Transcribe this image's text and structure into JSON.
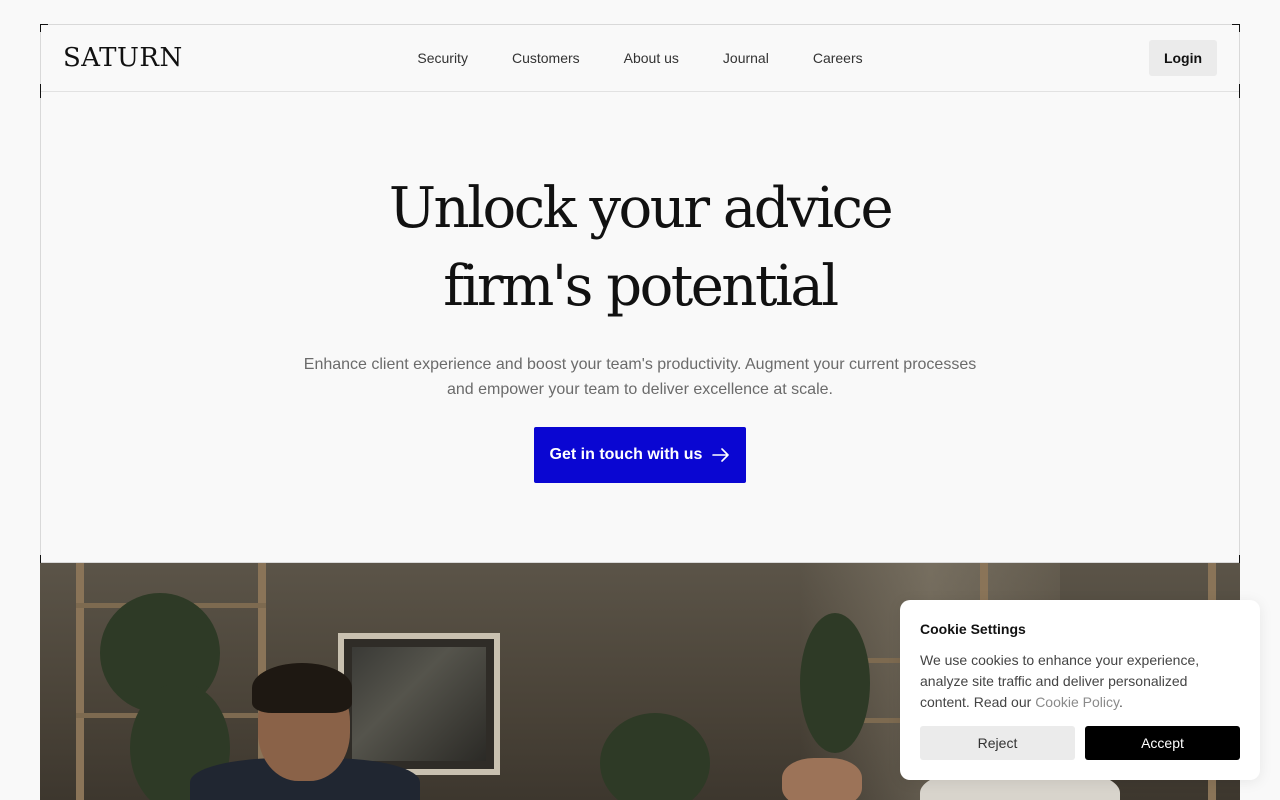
{
  "header": {
    "logo": "SATURN",
    "nav": [
      {
        "label": "Security"
      },
      {
        "label": "Customers"
      },
      {
        "label": "About us"
      },
      {
        "label": "Journal"
      },
      {
        "label": "Careers"
      }
    ],
    "login_label": "Login"
  },
  "hero": {
    "title_line1": "Unlock your advice",
    "title_line2": "firm's potential",
    "subtitle_line1": "Enhance client experience and boost your team's productivity. Augment your current processes",
    "subtitle_line2": "and empower your team to deliver excellence at scale.",
    "cta_label": "Get in touch with us",
    "cta_icon": "arrow-right-icon",
    "cta_color": "#0a06d2"
  },
  "cookie": {
    "title": "Cookie Settings",
    "text": "We use cookies to enhance your experience, analyze site traffic and deliver personalized content. Read our ",
    "link_label": "Cookie Policy",
    "text_end": ".",
    "reject_label": "Reject",
    "accept_label": "Accept"
  }
}
